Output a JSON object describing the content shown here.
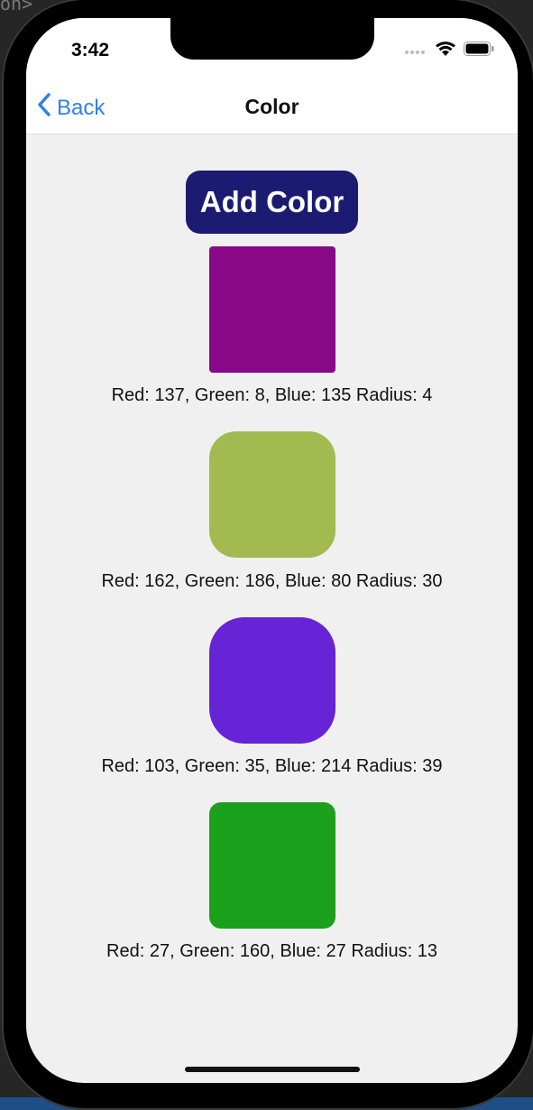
{
  "desktop": {
    "corner_fragment": "on>"
  },
  "status_bar": {
    "time": "3:42"
  },
  "nav": {
    "back_label": "Back",
    "title": "Color"
  },
  "main": {
    "add_button_label": "Add Color",
    "colors": [
      {
        "label": "Red: 137, Green: 8, Blue: 135 Radius: 4",
        "hex": "#890887",
        "radius": 4
      },
      {
        "label": "Red: 162, Green: 186, Blue: 80 Radius: 30",
        "hex": "#A2BA50",
        "radius": 30
      },
      {
        "label": "Red: 103, Green: 35, Blue: 214 Radius: 39",
        "hex": "#6723D6",
        "radius": 39
      },
      {
        "label": "Red: 27, Green: 160, Blue: 27 Radius: 13",
        "hex": "#1BA01B",
        "radius": 13
      }
    ]
  },
  "theme": {
    "accent": "#2F80ED",
    "button_bg": "#1B1B72",
    "screen_bg": "#F0F0F0"
  }
}
